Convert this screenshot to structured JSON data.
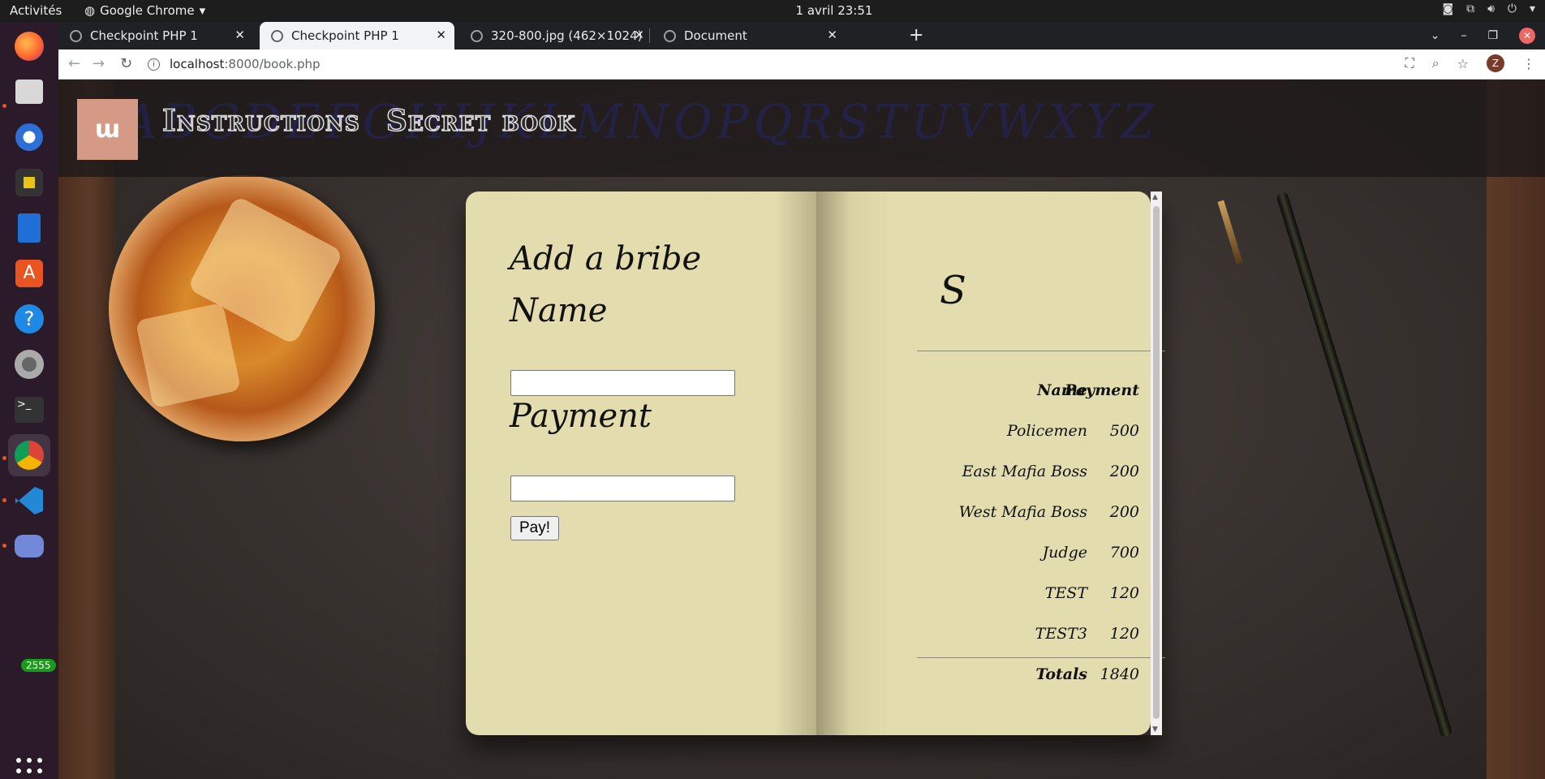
{
  "system": {
    "activities": "Activités",
    "app_menu": "Google Chrome",
    "clock": "1 avril  23:51"
  },
  "dock": {
    "badge": "2555",
    "items": [
      "firefox-icon",
      "files-icon",
      "thunderbird-icon",
      "rhythmbox-icon",
      "writer-icon",
      "software-icon",
      "help-icon",
      "settings-icon",
      "terminal-icon",
      "chrome-icon",
      "vscode-icon",
      "discord-icon"
    ]
  },
  "tabs": [
    {
      "title": "Checkpoint PHP 1"
    },
    {
      "title": "Checkpoint PHP 1"
    },
    {
      "title": "320-800.jpg (462×1024)"
    },
    {
      "title": "Document"
    }
  ],
  "address": {
    "host": "localhost",
    "path": ":8000/book.php"
  },
  "profile_initial": "Z",
  "site": {
    "nav": [
      "Instructions",
      "Secret book"
    ],
    "alphabet_overlay": "ABCDEFGHIJKLMNOPQRSTUVWXYZ"
  },
  "form": {
    "title": "Add a bribe",
    "name_label": "Name",
    "payment_label": "Payment",
    "button": "Pay!"
  },
  "ledger": {
    "heading": "S",
    "columns": [
      "Name",
      "Payment"
    ],
    "rows": [
      {
        "name": "Policemen",
        "payment": "500"
      },
      {
        "name": "East Mafia Boss",
        "payment": "200"
      },
      {
        "name": "West Mafia Boss",
        "payment": "200"
      },
      {
        "name": "Judge",
        "payment": "700"
      },
      {
        "name": "TEST",
        "payment": "120"
      },
      {
        "name": "TEST3",
        "payment": "120"
      }
    ],
    "total_label": "Totals",
    "total_value": "1840"
  },
  "colors": {
    "page": "#e3dcae",
    "logo": "#d49a85",
    "chrome_dark": "#202124"
  }
}
